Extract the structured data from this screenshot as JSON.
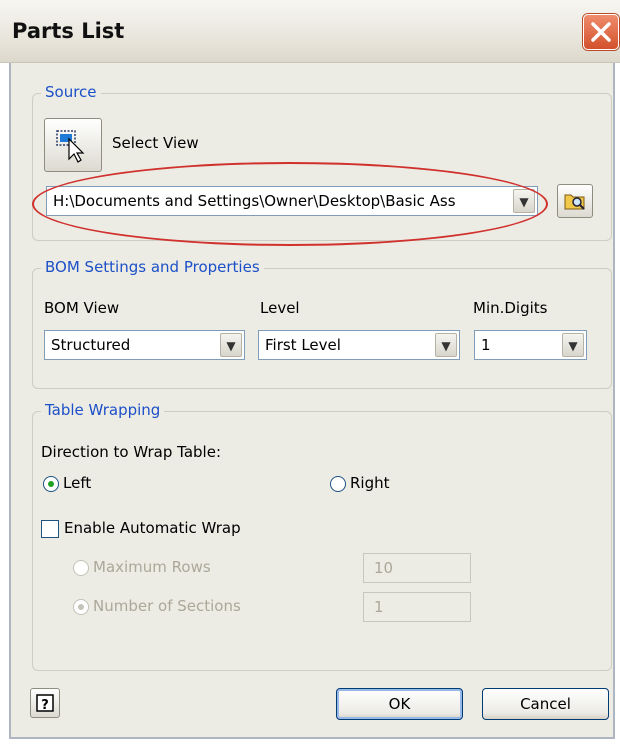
{
  "window": {
    "title": "Parts List"
  },
  "source": {
    "legend": "Source",
    "select_view_label": "Select View",
    "path_value": "H:\\Documents and Settings\\Owner\\Desktop\\Basic Ass"
  },
  "bom": {
    "legend": "BOM Settings and Properties",
    "bom_view_label": "BOM View",
    "bom_view_value": "Structured",
    "level_label": "Level",
    "level_value": "First Level",
    "min_digits_label": "Min.Digits",
    "min_digits_value": "1"
  },
  "wrapping": {
    "legend": "Table Wrapping",
    "direction_label": "Direction to Wrap Table:",
    "left_label": "Left",
    "right_label": "Right",
    "left_selected": true,
    "enable_auto_wrap_label": "Enable Automatic Wrap",
    "enable_auto_wrap_checked": false,
    "max_rows_label": "Maximum Rows",
    "max_rows_value": "10",
    "num_sections_label": "Number of Sections",
    "num_sections_value": "1"
  },
  "footer": {
    "ok_label": "OK",
    "cancel_label": "Cancel"
  },
  "colors": {
    "legend": "#1c50c8",
    "highlight_ellipse": "#d0312d",
    "close_button": "#d3512c"
  },
  "icons": [
    "close-icon",
    "select-view-icon",
    "browse-folder-icon",
    "dropdown-arrow-icon",
    "help-icon"
  ]
}
